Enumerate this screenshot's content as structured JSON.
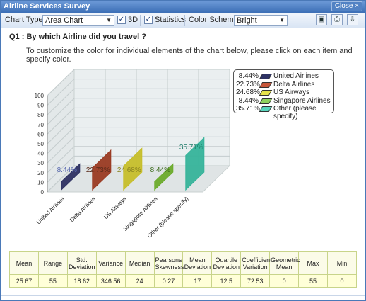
{
  "window": {
    "title": "Airline Services Survey",
    "close_label": "Close ×"
  },
  "toolbar": {
    "chart_type_label": "Chart Type:",
    "chart_type_value": "Area Chart",
    "three_d_label": "3D",
    "three_d_checked": true,
    "statistics_label": "Statistics",
    "statistics_checked": true,
    "color_scheme_label": "Color Scheme:",
    "color_scheme_value": "Bright",
    "icons": [
      "save-icon",
      "print-icon",
      "export-icon"
    ]
  },
  "question": "Q1 : By which Airline did you travel ?",
  "instruction": "To customize the color for individual elements of the chart below, please click on each item and specify color.",
  "chart_data": {
    "type": "area",
    "three_d": true,
    "categories": [
      "United Airlines",
      "Delta Airlines",
      "US Airways",
      "Singapore Airlines",
      "Other (please specify)"
    ],
    "values": [
      8.44,
      22.73,
      24.68,
      8.44,
      35.71
    ],
    "data_labels": [
      "8.44%",
      "22.73%",
      "24.68%",
      "8.44%",
      "35.71%"
    ],
    "colors": [
      "#2e3263",
      "#9a3a22",
      "#c6be2a",
      "#6bab2b",
      "#36b39a"
    ],
    "label_colors": [
      "#5a6ab0",
      "#5a2a1a",
      "#8a8420",
      "#3a6a1a",
      "#1a7a66"
    ],
    "ylim": [
      0,
      100
    ],
    "yticks": [
      "0",
      "10",
      "20",
      "30",
      "40",
      "50",
      "60",
      "70",
      "80",
      "90",
      "100"
    ],
    "grid": true,
    "legend_placement": "top-right"
  },
  "legend": [
    {
      "pct": "8.44%",
      "name": "United Airlines",
      "color": "#2e3263"
    },
    {
      "pct": "22.73%",
      "name": "Delta Airlines",
      "color": "#c8573a"
    },
    {
      "pct": "24.68%",
      "name": "US Airways",
      "color": "#e6e24a"
    },
    {
      "pct": "8.44%",
      "name": "Singapore Airlines",
      "color": "#8fd25e"
    },
    {
      "pct": "35.71%",
      "name": "Other (please specify)",
      "color": "#58d6be"
    }
  ],
  "stats": {
    "headers": [
      "Mean",
      "Range",
      "Std. Deviation",
      "Variance",
      "Median",
      "Pearsons Skewness",
      "Mean Deviation",
      "Quartile Deviation",
      "Coefficient Variation",
      "Geometric Mean",
      "Max",
      "Min"
    ],
    "values": [
      "25.67",
      "55",
      "18.62",
      "346.56",
      "24",
      "0.27",
      "17",
      "12.5",
      "72.53",
      "0",
      "55",
      "0"
    ]
  }
}
